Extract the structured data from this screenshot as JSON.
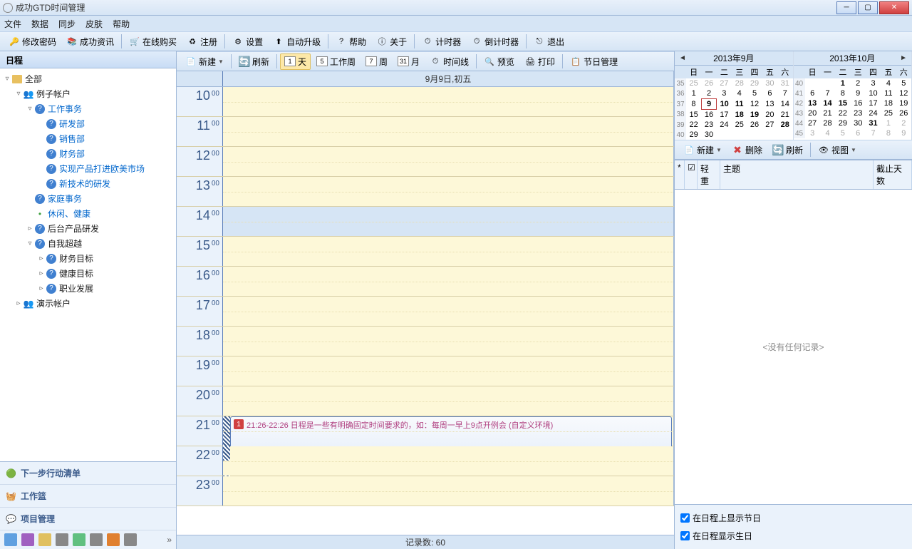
{
  "window": {
    "title": "成功GTD时间管理"
  },
  "menubar": [
    "文件",
    "数据",
    "同步",
    "皮肤",
    "帮助"
  ],
  "maintoolbar": [
    {
      "label": "修改密码",
      "icon": "key"
    },
    {
      "label": "成功资讯",
      "icon": "books"
    },
    {
      "sep": true
    },
    {
      "label": "在线购买",
      "icon": "cart"
    },
    {
      "label": "注册",
      "icon": "recycle"
    },
    {
      "sep": true
    },
    {
      "label": "设置",
      "icon": "gear"
    },
    {
      "label": "自动升级",
      "icon": "up"
    },
    {
      "sep": true
    },
    {
      "label": "帮助",
      "icon": "help"
    },
    {
      "label": "关于",
      "icon": "info"
    },
    {
      "sep": true
    },
    {
      "label": "计时器",
      "icon": "clock"
    },
    {
      "label": "倒计时器",
      "icon": "clock"
    },
    {
      "sep": true
    },
    {
      "label": "退出",
      "icon": "exit"
    }
  ],
  "left": {
    "header": "日程",
    "tree": [
      {
        "ind": 0,
        "toggle": "▿",
        "icon": "folder",
        "label": "全部"
      },
      {
        "ind": 1,
        "toggle": "▿",
        "icon": "users",
        "label": "例子帐户"
      },
      {
        "ind": 2,
        "toggle": "▿",
        "icon": "q",
        "label": "工作事务",
        "link": true
      },
      {
        "ind": 3,
        "toggle": "",
        "icon": "q",
        "label": "研发部",
        "link": true
      },
      {
        "ind": 3,
        "toggle": "",
        "icon": "q",
        "label": "销售部",
        "link": true
      },
      {
        "ind": 3,
        "toggle": "",
        "icon": "q",
        "label": "财务部",
        "link": true
      },
      {
        "ind": 3,
        "toggle": "",
        "icon": "q",
        "label": "实现产品打进欧美市场",
        "link": true
      },
      {
        "ind": 3,
        "toggle": "",
        "icon": "q",
        "label": "新技术的研发",
        "link": true
      },
      {
        "ind": 2,
        "toggle": "",
        "icon": "q",
        "label": "家庭事务",
        "link": true
      },
      {
        "ind": 2,
        "toggle": "",
        "icon": "dot",
        "label": "休闲、健康",
        "link": true
      },
      {
        "ind": 2,
        "toggle": "▹",
        "icon": "q",
        "label": "后台产品研发"
      },
      {
        "ind": 2,
        "toggle": "▿",
        "icon": "q",
        "label": "自我超越"
      },
      {
        "ind": 3,
        "toggle": "▹",
        "icon": "q",
        "label": "财务目标"
      },
      {
        "ind": 3,
        "toggle": "▹",
        "icon": "q",
        "label": "健康目标"
      },
      {
        "ind": 3,
        "toggle": "▹",
        "icon": "q",
        "label": "职业发展"
      },
      {
        "ind": 1,
        "toggle": "▹",
        "icon": "users",
        "label": "演示帐户"
      }
    ],
    "navlinks": [
      {
        "label": "下一步行动清单",
        "icon": "green-ball"
      },
      {
        "label": "工作篮",
        "icon": "basket"
      },
      {
        "label": "项目管理",
        "icon": "chat"
      }
    ]
  },
  "scheduletoolbar": [
    {
      "label": "新建",
      "icon": "new",
      "dd": true
    },
    {
      "sep": true
    },
    {
      "label": "刷新",
      "icon": "refresh"
    },
    {
      "sep": true
    },
    {
      "label": "天",
      "icon": "1",
      "active": true
    },
    {
      "label": "工作周",
      "icon": "5"
    },
    {
      "label": "周",
      "icon": "7"
    },
    {
      "label": "月",
      "icon": "31"
    },
    {
      "label": "时间线",
      "icon": "clock"
    },
    {
      "sep": true
    },
    {
      "label": "预览",
      "icon": "preview"
    },
    {
      "label": "打印",
      "icon": "print"
    },
    {
      "sep": true
    },
    {
      "label": "节日管理",
      "icon": "flag"
    }
  ],
  "schedule": {
    "dayheader": "9月9日,初五",
    "hours": [
      10,
      11,
      12,
      13,
      14,
      15,
      16,
      17,
      18,
      19,
      20,
      21,
      22,
      23
    ],
    "event": {
      "badge": "1",
      "text": "21:26-22:26 日程是一些有明确固定时间要求的，如：每周一早上9点开例会 (自定义环境)",
      "startHour": 21
    }
  },
  "status": {
    "label": "记录数:",
    "count": 60
  },
  "calendars": [
    {
      "title": "2013年9月",
      "arrow": "left",
      "wkstart": 35,
      "dow": [
        "日",
        "一",
        "二",
        "三",
        "四",
        "五",
        "六"
      ],
      "rows": [
        [
          35,
          {
            "d": 25,
            "o": 1
          },
          {
            "d": 26,
            "o": 1
          },
          {
            "d": 27,
            "o": 1
          },
          {
            "d": 28,
            "o": 1
          },
          {
            "d": 29,
            "o": 1
          },
          {
            "d": 30,
            "o": 1
          },
          {
            "d": 31,
            "o": 1
          }
        ],
        [
          36,
          {
            "d": 1
          },
          {
            "d": 2
          },
          {
            "d": 3
          },
          {
            "d": 4
          },
          {
            "d": 5
          },
          {
            "d": 6
          },
          {
            "d": 7
          }
        ],
        [
          37,
          {
            "d": 8
          },
          {
            "d": 9,
            "today": 1,
            "b": 1
          },
          {
            "d": 10,
            "b": 1
          },
          {
            "d": 11,
            "b": 1
          },
          {
            "d": 12
          },
          {
            "d": 13
          },
          {
            "d": 14
          }
        ],
        [
          38,
          {
            "d": 15
          },
          {
            "d": 16
          },
          {
            "d": 17
          },
          {
            "d": 18,
            "b": 1
          },
          {
            "d": 19,
            "b": 1
          },
          {
            "d": 20
          },
          {
            "d": 21
          }
        ],
        [
          39,
          {
            "d": 22
          },
          {
            "d": 23
          },
          {
            "d": 24
          },
          {
            "d": 25
          },
          {
            "d": 26
          },
          {
            "d": 27
          },
          {
            "d": 28,
            "b": 1
          }
        ],
        [
          40,
          {
            "d": 29
          },
          {
            "d": 30
          },
          {
            "d": "",
            "o": 1
          },
          {
            "d": "",
            "o": 1
          },
          {
            "d": "",
            "o": 1
          },
          {
            "d": "",
            "o": 1
          },
          {
            "d": "",
            "o": 1
          }
        ]
      ]
    },
    {
      "title": "2013年10月",
      "arrow": "right",
      "dow": [
        "日",
        "一",
        "二",
        "三",
        "四",
        "五",
        "六"
      ],
      "rows": [
        [
          40,
          {
            "d": "",
            "o": 1
          },
          {
            "d": "",
            "o": 1
          },
          {
            "d": 1,
            "b": 1
          },
          {
            "d": 2
          },
          {
            "d": 3
          },
          {
            "d": 4
          },
          {
            "d": 5
          }
        ],
        [
          41,
          {
            "d": 6
          },
          {
            "d": 7
          },
          {
            "d": 8
          },
          {
            "d": 9
          },
          {
            "d": 10
          },
          {
            "d": 11
          },
          {
            "d": 12
          }
        ],
        [
          42,
          {
            "d": 13,
            "b": 1
          },
          {
            "d": 14,
            "b": 1
          },
          {
            "d": 15,
            "b": 1
          },
          {
            "d": 16
          },
          {
            "d": 17
          },
          {
            "d": 18
          },
          {
            "d": 19
          }
        ],
        [
          43,
          {
            "d": 20
          },
          {
            "d": 21
          },
          {
            "d": 22
          },
          {
            "d": 23
          },
          {
            "d": 24
          },
          {
            "d": 25
          },
          {
            "d": 26
          }
        ],
        [
          44,
          {
            "d": 27
          },
          {
            "d": 28
          },
          {
            "d": 29
          },
          {
            "d": 30
          },
          {
            "d": 31,
            "b": 1
          },
          {
            "d": 1,
            "o": 1
          },
          {
            "d": 2,
            "o": 1
          }
        ],
        [
          45,
          {
            "d": 3,
            "o": 1
          },
          {
            "d": 4,
            "o": 1
          },
          {
            "d": 5,
            "o": 1
          },
          {
            "d": 6,
            "o": 1
          },
          {
            "d": 7,
            "o": 1
          },
          {
            "d": 8,
            "o": 1
          },
          {
            "d": 9,
            "o": 1
          }
        ]
      ]
    }
  ],
  "righttoolbar": [
    {
      "label": "新建",
      "icon": "new",
      "dd": true
    },
    {
      "label": "删除",
      "icon": "delete"
    },
    {
      "label": "刷新",
      "icon": "refresh"
    },
    {
      "sep": true
    },
    {
      "label": "视图",
      "icon": "view",
      "dd": true
    }
  ],
  "rightlist": {
    "cols": [
      "*",
      "☑",
      "轻重",
      "主题",
      "截止天数"
    ],
    "empty": "<没有任何记录>"
  },
  "checks": [
    {
      "label": "在日程上显示节日",
      "checked": true
    },
    {
      "label": "在日程显示生日",
      "checked": true
    }
  ]
}
